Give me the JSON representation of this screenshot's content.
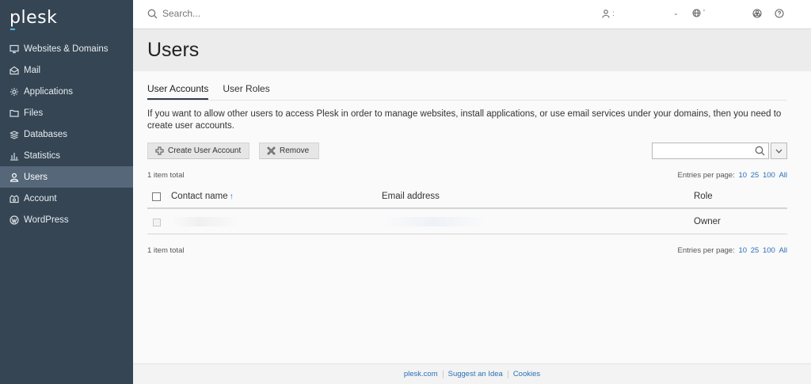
{
  "brand": {
    "logo": "plesk"
  },
  "sidebar": {
    "items": [
      {
        "label": "Websites & Domains",
        "icon": "monitor-icon",
        "active": false
      },
      {
        "label": "Mail",
        "icon": "mail-icon",
        "active": false
      },
      {
        "label": "Applications",
        "icon": "gear-icon",
        "active": false
      },
      {
        "label": "Files",
        "icon": "folder-icon",
        "active": false
      },
      {
        "label": "Databases",
        "icon": "database-icon",
        "active": false
      },
      {
        "label": "Statistics",
        "icon": "bar-chart-icon",
        "active": false
      },
      {
        "label": "Users",
        "icon": "user-icon",
        "active": true
      },
      {
        "label": "Account",
        "icon": "account-icon",
        "active": false
      },
      {
        "label": "WordPress",
        "icon": "wordpress-icon",
        "active": false
      }
    ],
    "collapse_glyph": "‹"
  },
  "topbar": {
    "search_placeholder": "Search...",
    "user_label": ":",
    "user_chevron": "⌄",
    "language_label": "'"
  },
  "header": {
    "title": "Users"
  },
  "tabs": [
    {
      "label": "User Accounts",
      "active": true
    },
    {
      "label": "User Roles",
      "active": false
    }
  ],
  "intro_text": "If you want to allow other users to access Plesk in order to manage websites, install applications, or use email services under your domains, then you need to create user accounts.",
  "toolbar": {
    "create_label": "Create User Account",
    "remove_label": "Remove",
    "filter_value": ""
  },
  "list": {
    "total_top": "1 item total",
    "total_bottom": "1 item total",
    "entries_label": "Entries per page:",
    "entries_options": [
      "10",
      "25",
      "100",
      "All"
    ],
    "columns": {
      "name": "Contact name",
      "sort_arrow": "↑",
      "email": "Email address",
      "role": "Role"
    },
    "rows": [
      {
        "name": "",
        "email": "",
        "role": "Owner"
      }
    ]
  },
  "footer": {
    "links": [
      "plesk.com",
      "Suggest an Idea",
      "Cookies"
    ]
  },
  "colors": {
    "sidebar_bg": "#354553",
    "sidebar_active": "#56677a",
    "link": "#2970b8",
    "accent": "#53bce6"
  }
}
